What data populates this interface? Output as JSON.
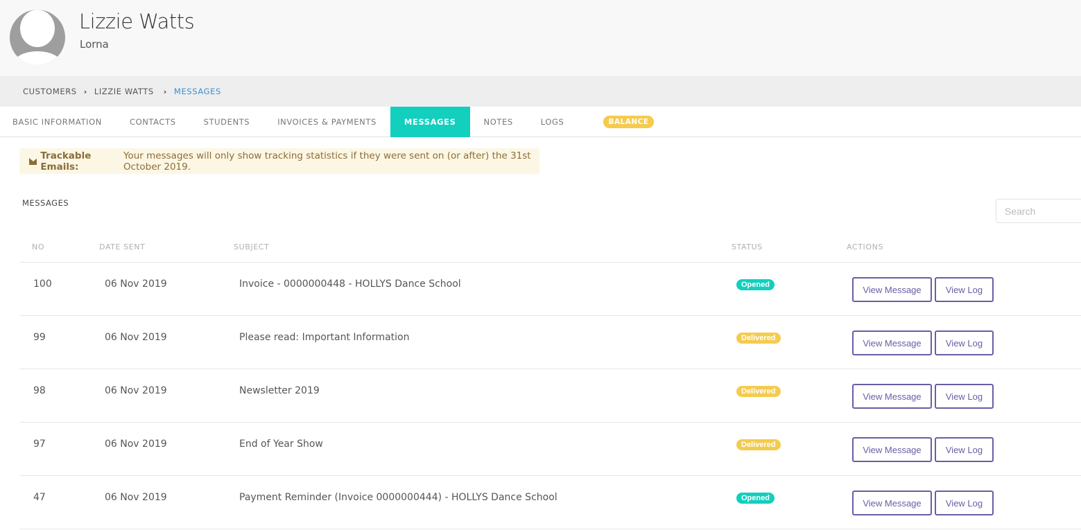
{
  "profile": {
    "name": "Lizzie Watts",
    "subtitle": "Lorna"
  },
  "breadcrumb": {
    "items": [
      "CUSTOMERS",
      "LIZZIE WATTS",
      "MESSAGES"
    ],
    "separator": "›"
  },
  "tabs": [
    {
      "label": "BASIC INFORMATION",
      "active": false
    },
    {
      "label": "CONTACTS",
      "active": false
    },
    {
      "label": "STUDENTS",
      "active": false
    },
    {
      "label": "INVOICES & PAYMENTS",
      "active": false
    },
    {
      "label": "MESSAGES",
      "active": true
    },
    {
      "label": "NOTES",
      "active": false
    },
    {
      "label": "LOGS",
      "active": false
    },
    {
      "label": "BALANCE",
      "active": false,
      "badge": true
    }
  ],
  "alert": {
    "icon": "envelope-icon",
    "title": "Trackable Emails:",
    "text": "Your messages will only show tracking statistics if they were sent on (or after) the 31st October 2019."
  },
  "messages": {
    "title": "MESSAGES",
    "search_placeholder": "Search",
    "columns": [
      "NO",
      "DATE SENT",
      "SUBJECT",
      "STATUS",
      "ACTIONS"
    ],
    "rows": [
      {
        "no": "100",
        "date": "06 Nov 2019",
        "subject": "Invoice - 0000000448 - HOLLYS Dance School",
        "status": "Opened",
        "view_message": "View Message",
        "view_log": "View Log"
      },
      {
        "no": "99",
        "date": "06 Nov 2019",
        "subject": "Please read: Important Information",
        "status": "Delivered",
        "view_message": "View Message",
        "view_log": "View Log"
      },
      {
        "no": "98",
        "date": "06 Nov 2019",
        "subject": "Newsletter 2019",
        "status": "Delivered",
        "view_message": "View Message",
        "view_log": "View Log"
      },
      {
        "no": "97",
        "date": "06 Nov 2019",
        "subject": "End of Year Show",
        "status": "Delivered",
        "view_message": "View Message",
        "view_log": "View Log"
      },
      {
        "no": "47",
        "date": "06 Nov 2019",
        "subject": "Payment Reminder (Invoice 0000000444) - HOLLYS Dance School",
        "status": "Opened",
        "view_message": "View Message",
        "view_log": "View Log"
      }
    ]
  },
  "colors": {
    "accent": "#12cfbe",
    "warning": "#f5cb4d",
    "button": "#6b5ca5",
    "breadcrumb_active": "#3a8fd6"
  }
}
